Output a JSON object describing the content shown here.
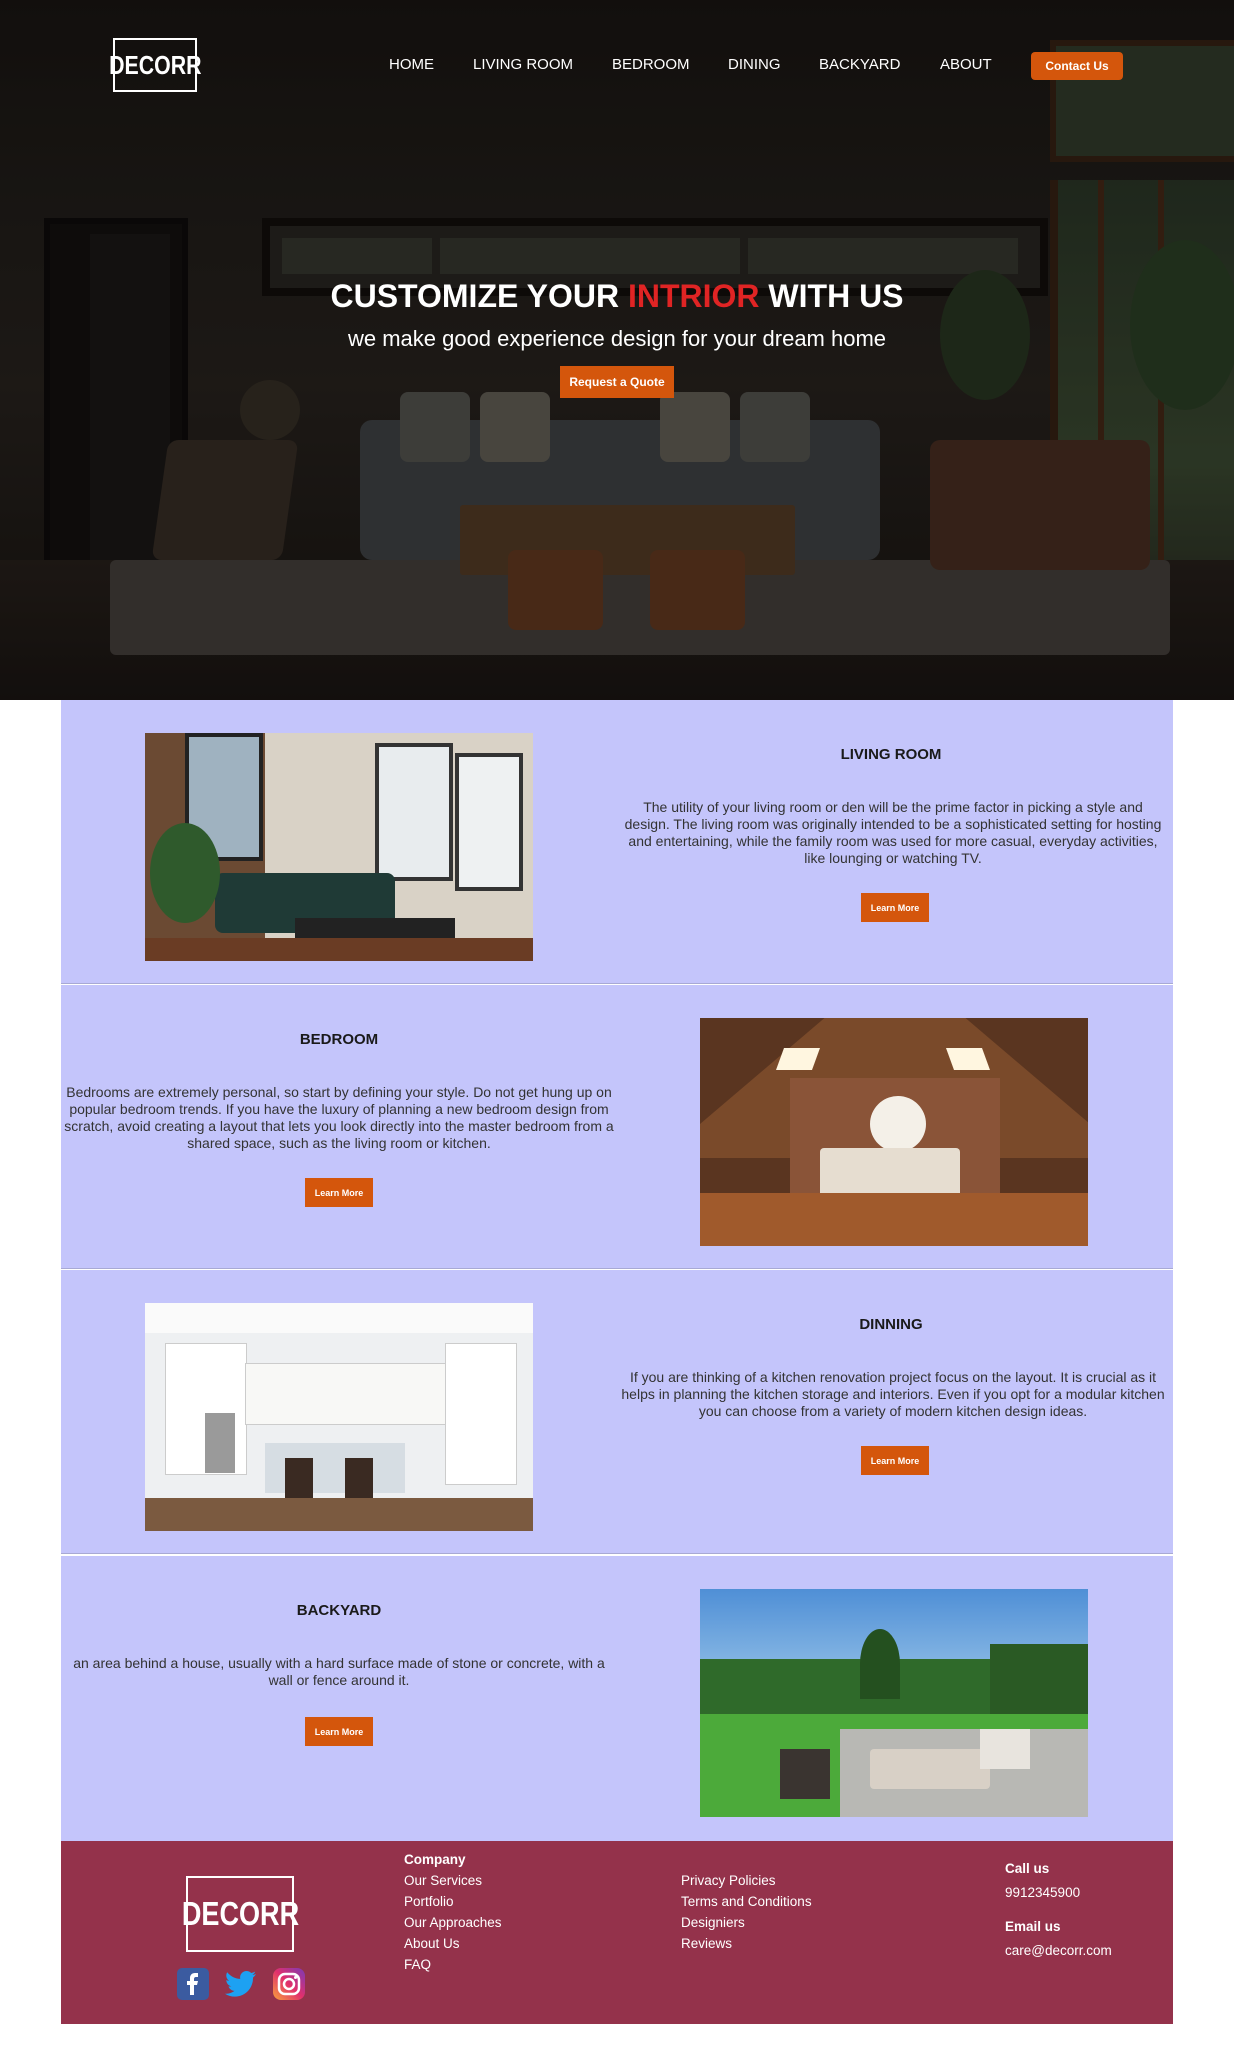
{
  "brand": {
    "logo_text": "DECORR"
  },
  "nav": {
    "items": [
      {
        "label": "HOME"
      },
      {
        "label": "LIVING ROOM"
      },
      {
        "label": "BEDROOM"
      },
      {
        "label": "DINING"
      },
      {
        "label": "BACKYARD"
      },
      {
        "label": "ABOUT"
      }
    ],
    "contact_label": "Contact Us"
  },
  "hero": {
    "title_part1": "CUSTOMIZE YOUR ",
    "title_accent": "INTRIOR",
    "title_part2": " WITH US",
    "subtitle": "we make good experience design for your dream home",
    "cta_label": "Request a Quote"
  },
  "sections": [
    {
      "title": "LIVING ROOM",
      "text": "The utility of your living room or den will be the prime factor in picking a style and design. The living room was originally intended to be a sophisticated setting for hosting and entertaining, while the family room was used for more casual, everyday activities, like lounging or watching TV.",
      "button": "Learn More"
    },
    {
      "title": "BEDROOM",
      "text": "Bedrooms are extremely personal, so start by defining your style. Do not get hung up on popular bedroom trends. If you have the luxury of planning a new bedroom design from scratch, avoid creating a layout that lets you look directly into the master bedroom from a shared space, such as the living room or kitchen.",
      "button": "Learn More"
    },
    {
      "title": "DINNING",
      "text": "If you are thinking of a kitchen renovation project focus on the layout. It is crucial as it helps in planning the kitchen storage and interiors. Even if you opt for a modular kitchen you can choose from a variety of modern kitchen design ideas.",
      "button": "Learn More"
    },
    {
      "title": "BACKYARD",
      "text": "an area behind a house, usually with a hard surface made of stone or concrete, with a wall or fence around it.",
      "button": "Learn More"
    }
  ],
  "footer": {
    "company": {
      "heading": "Company",
      "links": [
        "Our Services",
        "Portfolio",
        "Our Approaches",
        "About Us",
        "FAQ"
      ]
    },
    "legal": {
      "links": [
        "Privacy Policies",
        "Terms and Conditions",
        "Designiers",
        "Reviews"
      ]
    },
    "contact": {
      "call_heading": "Call us",
      "phone": "9912345900",
      "email_heading": "Email us",
      "email": "care@decorr.com"
    },
    "social": [
      "facebook-icon",
      "twitter-icon",
      "instagram-icon"
    ]
  },
  "colors": {
    "accent": "#d4560c",
    "hero_accent": "#e02424",
    "section_bg": "#c4c5fb",
    "footer_bg": "#94324b"
  }
}
